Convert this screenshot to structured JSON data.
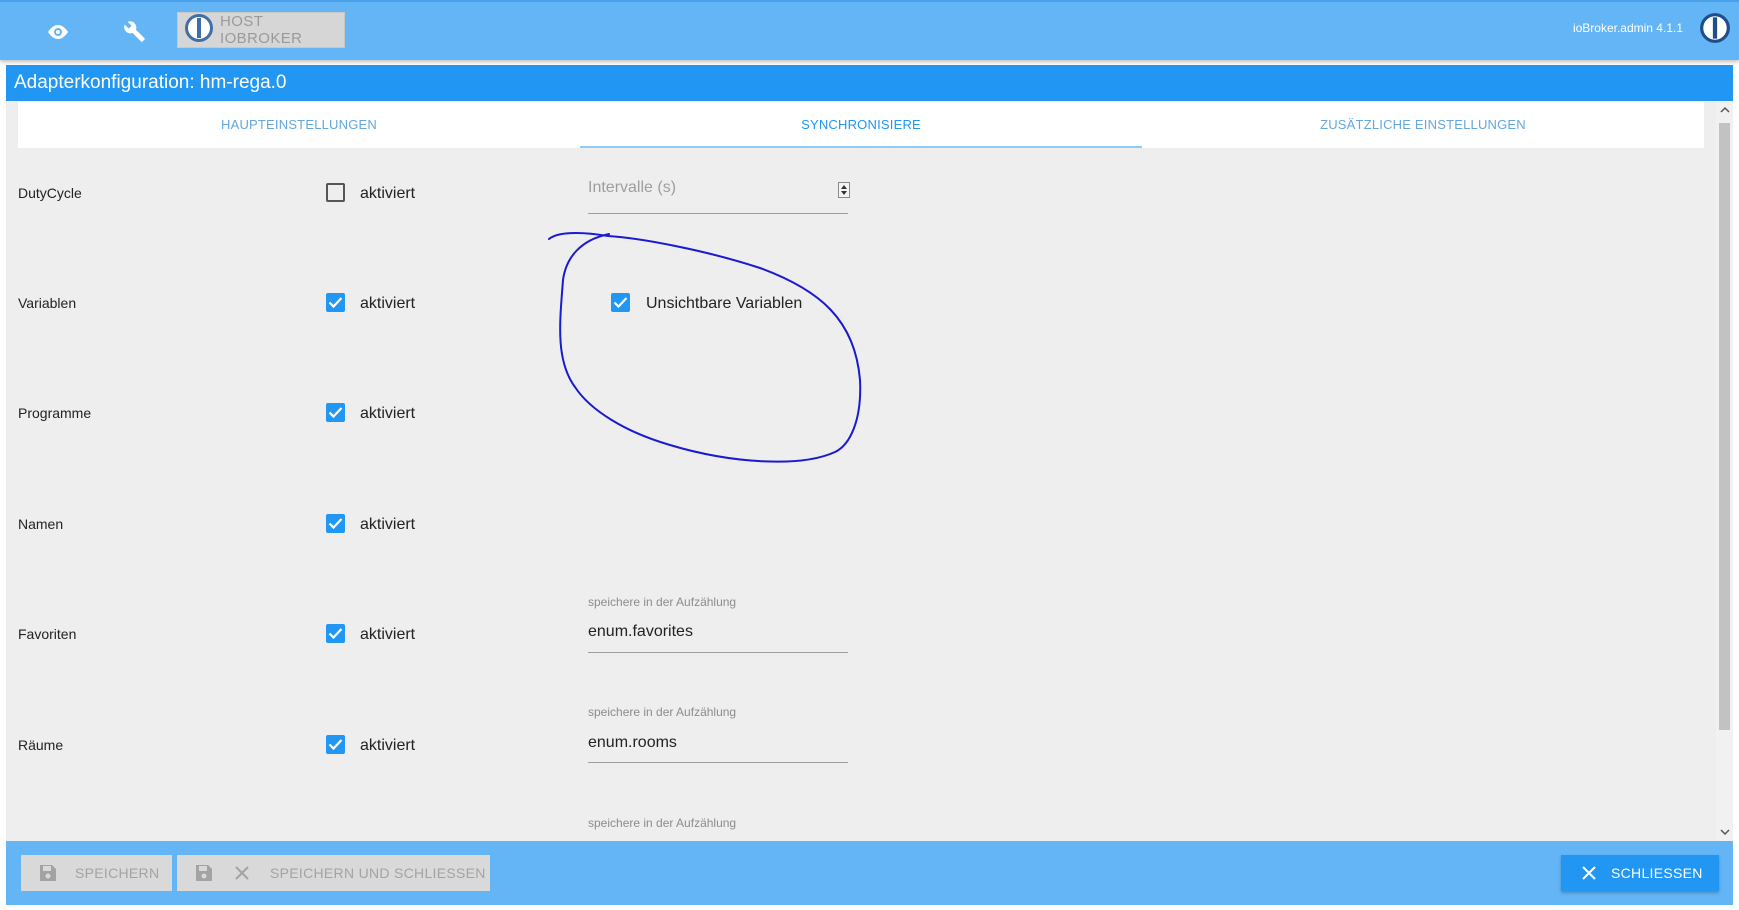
{
  "topbar": {
    "host_label": "HOST IOBROKER",
    "version": "ioBroker.admin 4.1.1",
    "icons": [
      "eye-icon",
      "wrench-icon",
      "iobroker-logo-icon"
    ]
  },
  "header": {
    "title": "Adapterkonfiguration: hm-rega.0"
  },
  "tabs": [
    {
      "label": "HAUPTEINSTELLUNGEN",
      "active": false
    },
    {
      "label": "SYNCHRONISIERE",
      "active": true
    },
    {
      "label": "ZUSÄTZLICHE EINSTELLUNGEN",
      "active": false
    }
  ],
  "rows": [
    {
      "label": "DutyCycle",
      "checked": false,
      "checkbox_label": "aktiviert"
    },
    {
      "label": "Variablen",
      "checked": true,
      "checkbox_label": "aktiviert"
    },
    {
      "label": "Programme",
      "checked": true,
      "checkbox_label": "aktiviert"
    },
    {
      "label": "Namen",
      "checked": true,
      "checkbox_label": "aktiviert"
    },
    {
      "label": "Favoriten",
      "checked": true,
      "checkbox_label": "aktiviert"
    },
    {
      "label": "Räume",
      "checked": true,
      "checkbox_label": "aktiviert"
    }
  ],
  "interval_field": {
    "placeholder": "Intervalle (s)"
  },
  "invisible_variables": {
    "label": "Unsichtbare Variablen",
    "checked": true
  },
  "enum_fields": [
    {
      "label": "speichere in der Aufzählung",
      "value": "enum.favorites"
    },
    {
      "label": "speichere in der Aufzählung",
      "value": "enum.rooms"
    },
    {
      "label": "speichere in der Aufzählung",
      "value": ""
    }
  ],
  "footer": {
    "save_label": "SPEICHERN",
    "save_close_label": "SPEICHERN UND SCHLIESSEN",
    "close_label": "SCHLIESSEN"
  },
  "colors": {
    "topbar": "#64b5f6",
    "header": "#2196f3",
    "checkbox": "#2196f3",
    "annotation": "#1a1ad0"
  }
}
